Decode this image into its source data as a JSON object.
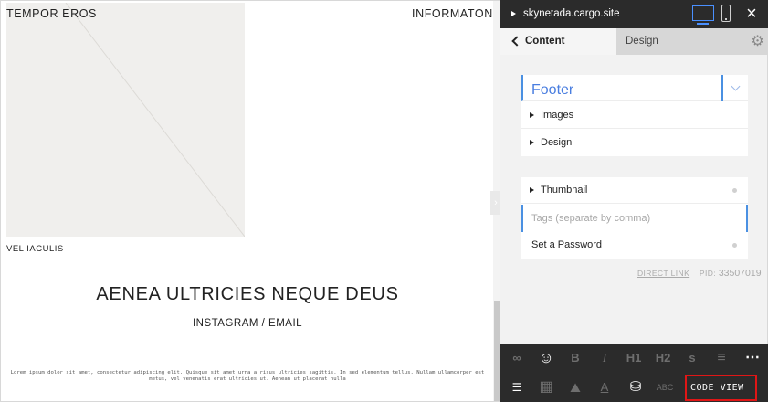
{
  "preview": {
    "site_title": "TEMPOR EROS",
    "nav_link": "INFORMATON",
    "image_caption": "VEL IACULIS",
    "headline": "AENEA ULTRICIES NEQUE DEUS",
    "contact_links": "INSTAGRAM / EMAIL",
    "footer_text": "Lorem ipsum dolor sit amet, consectetur adipiscing elit. Quisque sit amet urna a risus ultricies sagittis. In sed elementum tellus. Nullam ullamcorper est metus, vel venenatis erat ultricies ut. Aenean ut placerat nulla"
  },
  "panel": {
    "site_url": "skynetada.cargo.site",
    "close_icon": "×",
    "tabs": {
      "content": "Content",
      "design": "Design"
    },
    "section_group": {
      "selected_option": "Footer",
      "rows": [
        "Images",
        "Design"
      ]
    },
    "meta_group": {
      "thumbnail": "Thumbnail",
      "tags_placeholder": "Tags (separate by comma)",
      "tags_value": "",
      "password": "Set a Password"
    },
    "direct_link": "DIRECT LINK",
    "pid_label": "PID:",
    "pid_value": "33507019"
  },
  "toolbar": {
    "row1": [
      {
        "name": "link-icon",
        "glyph": "∞"
      },
      {
        "name": "emoji-icon",
        "glyph": "☺"
      },
      {
        "name": "bold-button",
        "glyph": "B"
      },
      {
        "name": "italic-button",
        "glyph": "I"
      },
      {
        "name": "h1-button",
        "glyph": "H1"
      },
      {
        "name": "h2-button",
        "glyph": "H2"
      },
      {
        "name": "small-text-button",
        "glyph": "s"
      },
      {
        "name": "align-center-icon",
        "glyph": "≡"
      },
      {
        "name": "more-icon",
        "glyph": "⋯"
      }
    ],
    "row2": [
      {
        "name": "list-icon",
        "glyph": "☰"
      },
      {
        "name": "grid-icon",
        "glyph": "▦"
      },
      {
        "name": "image-gallery-icon",
        "glyph": "⛰"
      },
      {
        "name": "text-style-icon",
        "glyph": "A"
      },
      {
        "name": "shop-icon",
        "glyph": "⛁"
      },
      {
        "name": "text-columns-icon",
        "glyph": "ABC"
      }
    ],
    "code_view": "CODE VIEW"
  }
}
